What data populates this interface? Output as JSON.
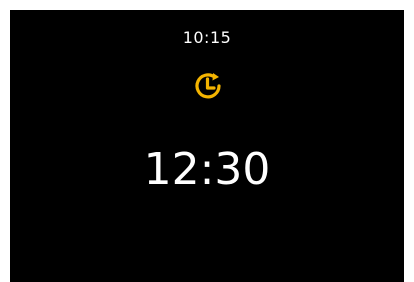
{
  "status": {
    "time": "10:15"
  },
  "timer": {
    "icon": "clock-refresh-icon",
    "color": "#F4B400"
  },
  "display": {
    "time": "12:30"
  },
  "colors": {
    "screen_bg": "#000000",
    "text": "#FFFFFF",
    "accent": "#F4B400"
  }
}
